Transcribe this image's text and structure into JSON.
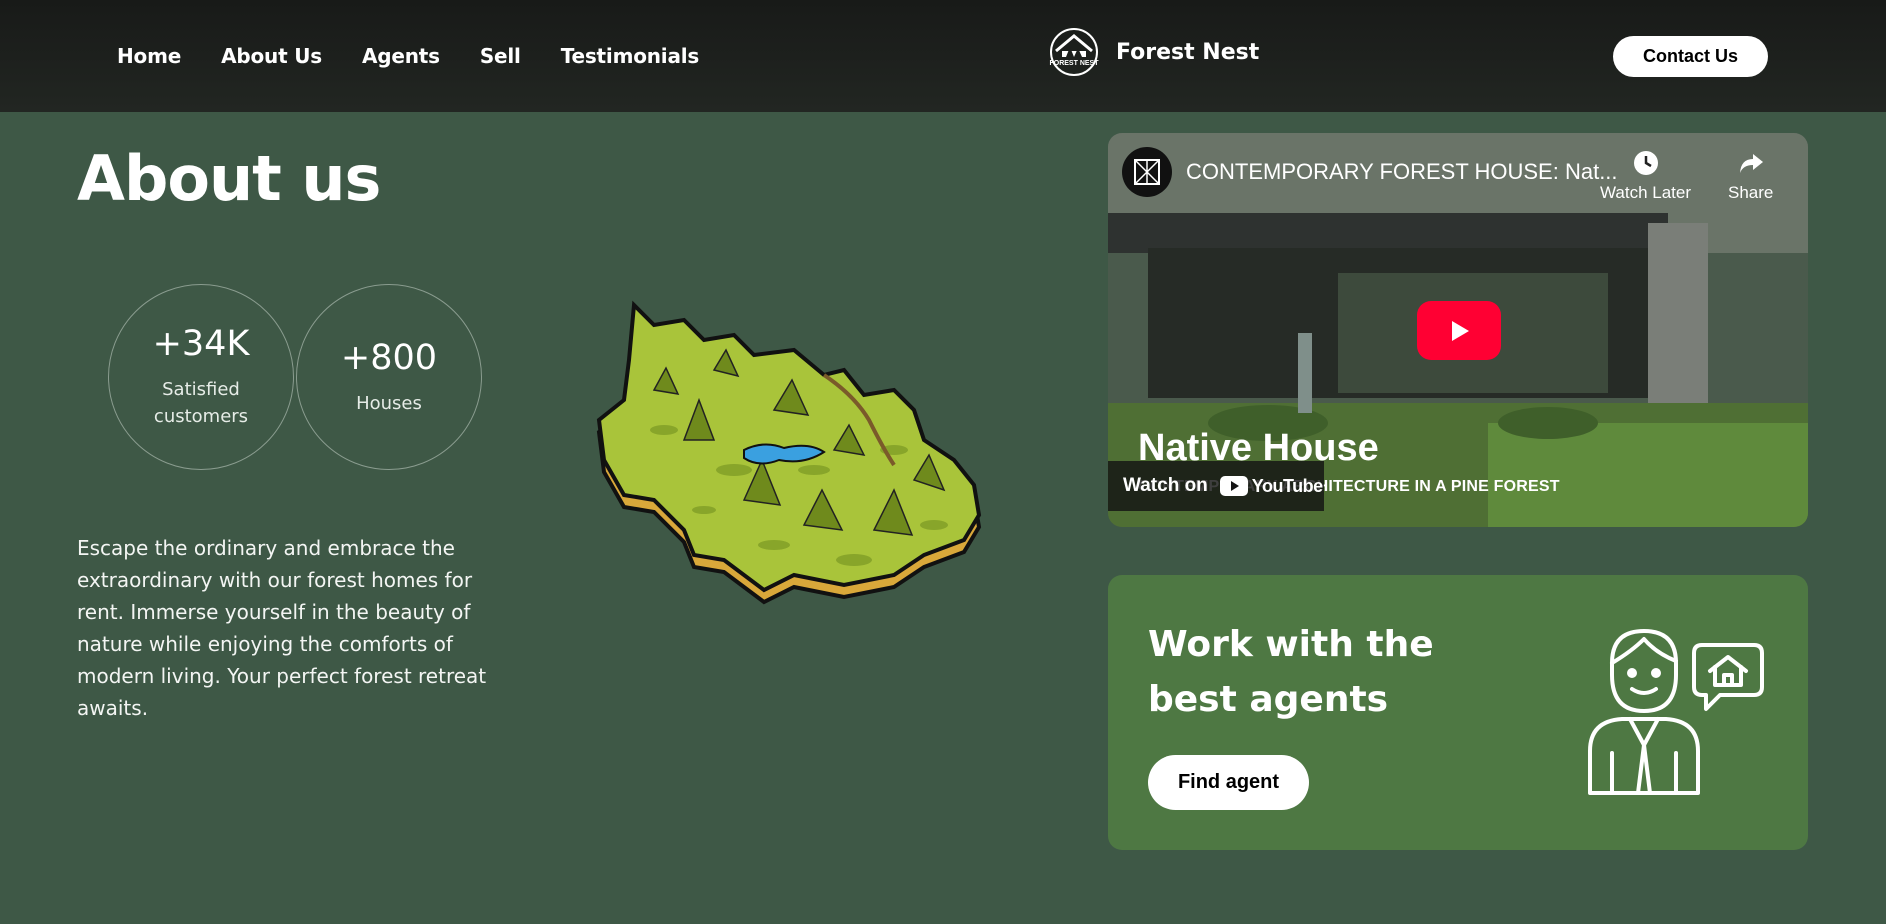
{
  "header": {
    "nav": [
      "Home",
      "About Us",
      "Agents",
      "Sell",
      "Testimonials"
    ],
    "brand_logo_text": "FOREST NEST",
    "brand_name": "Forest Nest",
    "contact_label": "Contact Us"
  },
  "about": {
    "title": "About us",
    "stats": [
      {
        "value": "+34K",
        "label": "Satisfied customers"
      },
      {
        "value": "+800",
        "label": "Houses"
      }
    ],
    "description": "Escape the ordinary and embrace the extraordinary with our forest homes for rent. Immerse yourself in the beauty of nature while enjoying the comforts of modern living. Your perfect forest retreat awaits."
  },
  "video": {
    "title": "CONTEMPORARY FOREST HOUSE: Nat...",
    "watch_later": "Watch Later",
    "share": "Share",
    "overlay_heading": "Native House",
    "overlay_sub": "CONTEMPORARY ARCHITECTURE IN A PINE FOREST",
    "watch_on": "Watch on",
    "youtube": "YouTube",
    "play_color": "#ff0033"
  },
  "agents": {
    "heading": "Work with the best agents",
    "button": "Find agent",
    "icon": "agent-house-icon"
  },
  "colors": {
    "page_bg": "#3e5846",
    "header_bg": "#1c1f1c",
    "card_bg": "#4e7843",
    "map_green": "#a9c43a"
  }
}
